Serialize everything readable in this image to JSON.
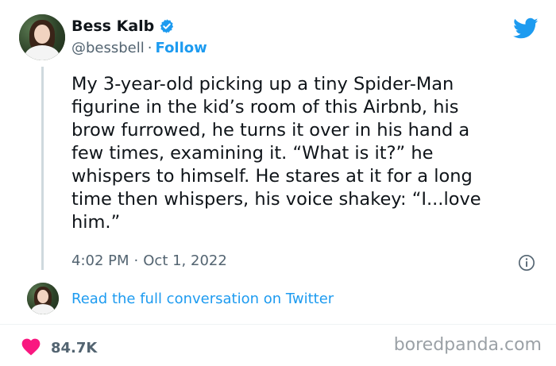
{
  "author": {
    "name": "Bess Kalb",
    "handle": "@bessbell",
    "separator": "·",
    "follow_label": "Follow"
  },
  "tweet": {
    "text": "My 3-year-old picking up a tiny Spider-Man\nfigurine in the kid’s room of this Airbnb, his\nbrow furrowed, he turns it over in his hand a\nfew times, examining it. “What is it?” he\nwhispers to himself. He stares at it for a long\ntime then whispers, his voice shakey: “I...love\nhim.”",
    "time": "4:02 PM",
    "separator": "·",
    "date": "Oct 1, 2022"
  },
  "conversation_link": "Read the full conversation on Twitter",
  "engagement": {
    "likes": "84.7K"
  },
  "watermark": "boredpanda.com",
  "colors": {
    "accent": "#1d9bf0",
    "heart": "#f91880",
    "muted": "#536471"
  },
  "icons": [
    "verified-badge-icon",
    "twitter-bird-icon",
    "info-icon",
    "heart-icon"
  ]
}
